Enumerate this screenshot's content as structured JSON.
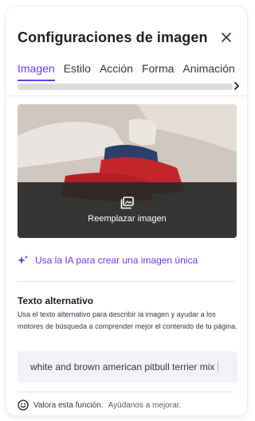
{
  "header": {
    "title": "Configuraciones de imagen"
  },
  "tabs": [
    {
      "label": "Imagen"
    },
    {
      "label": "Estilo"
    },
    {
      "label": "Acción"
    },
    {
      "label": "Forma"
    },
    {
      "label": "Animación"
    }
  ],
  "image": {
    "replace_label": "Reemplazar imagen"
  },
  "ai": {
    "label": "Usa la IA para crear una imagen única"
  },
  "alt_text": {
    "label": "Texto alternativo",
    "description": "Usa el texto alternativo para describir la imagen y ayudar a los motores de búsqueda a comprender mejor el contenido de tu página.",
    "value": "white and brown american pitbull terrier mix"
  },
  "feedback": {
    "prompt": "Valora esta función.",
    "link": "Ayúdanos a mejorar."
  },
  "colors": {
    "accent": "#673de6",
    "text": "#1d1e20",
    "overlay": "#282828"
  },
  "icons": [
    "close-icon",
    "chevron-right-icon",
    "image-replace-icon",
    "sparkle-icon",
    "smiley-icon"
  ]
}
